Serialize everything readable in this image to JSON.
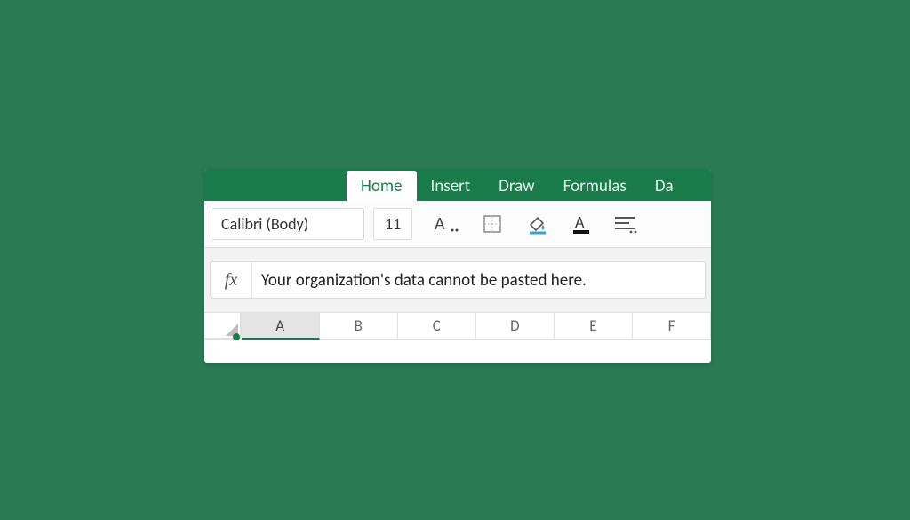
{
  "ribbon": {
    "tabs": [
      "Home",
      "Insert",
      "Draw",
      "Formulas",
      "Da"
    ],
    "active_index": 0
  },
  "font": {
    "name": "Calibri (Body)",
    "size": "11"
  },
  "icons": {
    "more_formatting": "A..",
    "borders": "borders",
    "fill": "fill-bucket",
    "font_color": "A",
    "align": "align-lines"
  },
  "formula_bar": {
    "label": "fx",
    "text": "Your organization's data cannot be pasted here."
  },
  "columns": [
    "A",
    "B",
    "C",
    "D",
    "E",
    "F"
  ],
  "selected_column_index": 0
}
